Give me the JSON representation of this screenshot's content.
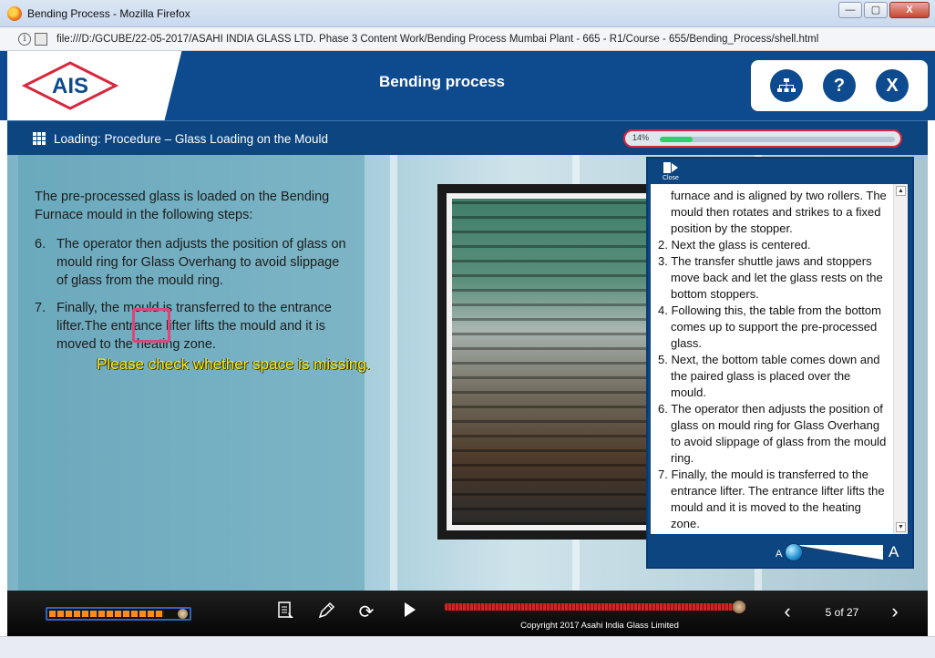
{
  "window": {
    "title": "Bending Process - Mozilla Firefox",
    "controls": {
      "minimize": "—",
      "maximize": "▢",
      "close": "X"
    }
  },
  "browser": {
    "url": "file:///D:/GCUBE/22-05-2017/ASAHI INDIA GLASS LTD. Phase 3 Content Work/Bending Process  Mumbai Plant - 665 - R1/Course - 655/Bending_Process/shell.html"
  },
  "header": {
    "logo_text": "AIS",
    "title": "Bending process",
    "buttons": {
      "menu_icon": "sitemap-icon",
      "help": "?",
      "exit": "X"
    }
  },
  "subheader": {
    "heading": "Loading: Procedure – Glass Loading on the Mould",
    "progress_label": "14%",
    "progress_value": 0.14
  },
  "main": {
    "intro": "The pre-processed glass is loaded on the Bending Furnace mould in the following steps:",
    "steps": [
      {
        "num": "6.",
        "text": "The operator then adjusts the position of glass on mould ring for Glass Overhang to avoid slippage of glass from the mould ring."
      },
      {
        "num": "7.",
        "text": "Finally, the mould is transferred to the entrance lifter.The entrance lifter lifts the mould and it is moved to the heating zone."
      }
    ],
    "review_note": "Please check whether space is missing."
  },
  "side_panel": {
    "close_label": "Close",
    "paragraphs": [
      {
        "cont": true,
        "text": "furnace and is aligned by two rollers. The mould then rotates and strikes to a fixed position by the stopper."
      },
      {
        "cont": false,
        "text": "2. Next  the glass is centered."
      },
      {
        "cont": false,
        "text": "3. The transfer shuttle jaws and stoppers move back and let the glass rests on the bottom stoppers."
      },
      {
        "cont": false,
        "text": "4. Following this, the table from the bottom comes up to support the pre-processed glass."
      },
      {
        "cont": false,
        "text": "5. Next, the bottom table comes down and the paired glass is placed over the mould."
      },
      {
        "cont": false,
        "text": "6. The operator then adjusts the position of glass on mould ring for Glass Overhang to avoid slippage of glass from the mould ring."
      },
      {
        "cont": false,
        "text": "7. Finally, the mould is transferred to the entrance lifter. The entrance lifter lifts the mould and it is moved to the heating zone."
      }
    ],
    "font_small": "A",
    "font_large": "A"
  },
  "footer": {
    "copyright": "Copyright 2017 Asahi India Glass Limited",
    "page": "5 of 27",
    "volume_level": 0.9,
    "seek_position": 0.98
  },
  "colors": {
    "brand_blue": "#0d4a8e",
    "accent_red": "#d9263c",
    "progress_green": "#2fd06a",
    "note_yellow": "#fff200"
  }
}
